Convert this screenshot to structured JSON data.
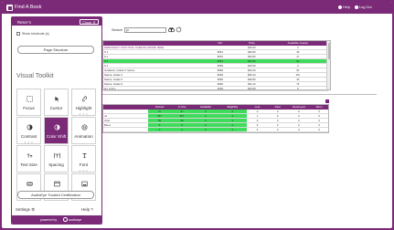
{
  "header": {
    "title": "Find A Book",
    "links": [
      "Help",
      "Log Out"
    ]
  },
  "search": {
    "label": "Search",
    "value": "ju"
  },
  "books": {
    "columns": [
      "",
      "ISC",
      "Price",
      "Available Copies"
    ],
    "rows": [
      {
        "title": "DEMOCRACY POLITICAL SCIENCE GRADE 3RDE",
        "isc": "",
        "price": "$15.00",
        "copies": "4",
        "style": "dim"
      },
      {
        "title": "S 1",
        "isc": "8051",
        "price": "$30.83",
        "copies": "45",
        "style": ""
      },
      {
        "title": "S 1",
        "isc": "8051",
        "price": "$30.83",
        "copies": "17",
        "style": ""
      },
      {
        "title": "S 1",
        "isc": "8051",
        "price": "$33.90",
        "copies": "60",
        "style": "sel"
      },
      {
        "title": "S 1",
        "isc": "8059",
        "price": "$15.00",
        "copies": "0",
        "style": ""
      },
      {
        "title": "Guidance, Grade 3, Series",
        "isc": "8060",
        "price": "$22.00",
        "copies": "60",
        "style": ""
      },
      {
        "title": "Nature, Grade 3",
        "isc": "8066",
        "price": "$50.44",
        "copies": "151",
        "style": ""
      },
      {
        "title": "Nature, Grade 5",
        "isc": "8066",
        "price": "$30.83",
        "copies": "40",
        "style": ""
      },
      {
        "title": "Nature, Grade 6",
        "isc": "8066",
        "price": "$32.13",
        "copies": "76",
        "style": ""
      },
      {
        "title": "ary, Unit 1",
        "isc": "2004",
        "price": "$13.09",
        "copies": "0",
        "style": ""
      }
    ]
  },
  "stock": {
    "columns": [
      "",
      "Owned",
      "In Use",
      "Available",
      "Eligibility",
      "Lost",
      "Paid",
      "Destroyed",
      "Worn"
    ],
    "rows": [
      {
        "name": "",
        "owned": "97",
        "inuse": "97",
        "avail": "0",
        "elig": "0",
        "lost": "0",
        "paid": "0",
        "destr": "0",
        "worn": "0"
      },
      {
        "name": "nd",
        "owned": "867",
        "inuse": "867",
        "avail": "0",
        "elig": "0",
        "lost": "1",
        "paid": "0",
        "destr": "0",
        "worn": "0"
      },
      {
        "name": "ched",
        "owned": "89",
        "inuse": "89",
        "avail": "0",
        "elig": "0",
        "lost": "0",
        "paid": "0",
        "destr": "0",
        "worn": "0"
      },
      {
        "name": "Bsed",
        "owned": "8",
        "inuse": "8",
        "avail": "0",
        "elig": "0",
        "lost": "0",
        "paid": "0",
        "destr": "0",
        "worn": "0"
      },
      {
        "name": "",
        "owned": "0",
        "inuse": "0",
        "avail": "0",
        "elig": "0",
        "lost": "0",
        "paid": "0",
        "destr": "0",
        "worn": "0"
      }
    ]
  },
  "toolkit": {
    "reset_label": "Reset",
    "close_label": "Close",
    "shortcuts_label": "Show shortcuts (s)",
    "page_structure_label": "Page Structure",
    "section_title": "Visual Toolkit",
    "tiles": [
      {
        "label": "Focus",
        "icon": "focus-icon",
        "active": false,
        "dots": ""
      },
      {
        "label": "Cursor",
        "icon": "cursor-icon",
        "active": false,
        "dots": ""
      },
      {
        "label": "Highlight",
        "icon": "link-icon",
        "active": false,
        "dots": "• • •"
      },
      {
        "label": "Contrast",
        "icon": "contrast-icon",
        "active": false,
        "dots": "• • •"
      },
      {
        "label": "Color Shift",
        "icon": "color-shift-icon",
        "active": true,
        "dots": ""
      },
      {
        "label": "Animation",
        "icon": "animation-icon",
        "active": false,
        "dots": ""
      },
      {
        "label": "Text Size",
        "icon": "text-size-icon",
        "active": false,
        "dots": ""
      },
      {
        "label": "Spacing",
        "icon": "spacing-icon",
        "active": false,
        "dots": ""
      },
      {
        "label": "Font",
        "icon": "font-icon",
        "active": false,
        "dots": "• • •"
      },
      {
        "label": "Guide",
        "icon": "guide-icon",
        "active": false,
        "dots": ""
      },
      {
        "label": "Window",
        "icon": "window-icon",
        "active": false,
        "dots": ""
      },
      {
        "label": "Images",
        "icon": "images-icon",
        "active": false,
        "dots": ""
      }
    ],
    "certification_label": "AudioEye Trusted Certification",
    "settings_label": "Settings",
    "help_label": "Help",
    "powered_label": "powered by",
    "brand_label": "audioeye"
  },
  "colors": {
    "accent": "#7b2a78",
    "highlight": "#3ddc5a"
  }
}
